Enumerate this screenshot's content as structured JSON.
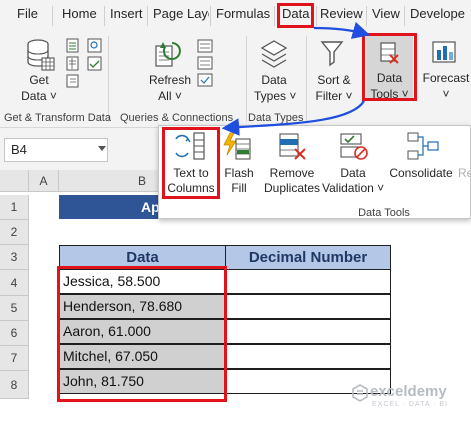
{
  "tabs": {
    "file": "File",
    "home": "Home",
    "insert": "Insert",
    "page_layout": "Page Layo",
    "formulas": "Formulas",
    "data": "Data",
    "review": "Review",
    "view": "View",
    "developer": "Develope"
  },
  "ribbon": {
    "get_data": [
      "Get",
      "Data ˅"
    ],
    "refresh_all": [
      "Refresh",
      "All ˅"
    ],
    "data_types": [
      "Data",
      "Types ˅"
    ],
    "sort_filter": [
      "Sort &",
      "Filter ˅"
    ],
    "data_tools": [
      "Data",
      "Tools ˅"
    ],
    "forecast": [
      "Forecast",
      "˅"
    ],
    "groups": {
      "get_transform": "Get & Transform Data",
      "queries": "Queries & Connections",
      "data_types": "Data Types"
    }
  },
  "name_box": "B4",
  "data_tools_panel": {
    "text_to_columns": [
      "Text to",
      "Columns"
    ],
    "flash_fill": [
      "Flash",
      "Fill"
    ],
    "remove_duplicates": [
      "Remove",
      "Duplicates"
    ],
    "data_validation": [
      "Data",
      "Validation ˅"
    ],
    "consolidate": "Consolidate",
    "relationships": "Re",
    "group_label": "Data Tools"
  },
  "sheet": {
    "columns": [
      "A",
      "B"
    ],
    "rows": [
      "1",
      "2",
      "3",
      "4",
      "5",
      "6",
      "7",
      "8"
    ],
    "title_fragment": "Ap",
    "headers": [
      "Data",
      "Decimal Number"
    ],
    "data_cells": [
      "Jessica, 58.500",
      "Henderson, 78.680",
      "Aaron, 61.000",
      "Mitchel, 67.050",
      "John, 81.750"
    ]
  },
  "watermark": {
    "brand": "exceldemy",
    "tagline": "EXCEL · DATA · BI"
  },
  "colors": {
    "highlight": "#e0131c",
    "arrow": "#1f4ee0",
    "title_fill": "#2f5597",
    "header_fill": "#b4c7e7",
    "selected_fill": "#d0d0d0"
  }
}
